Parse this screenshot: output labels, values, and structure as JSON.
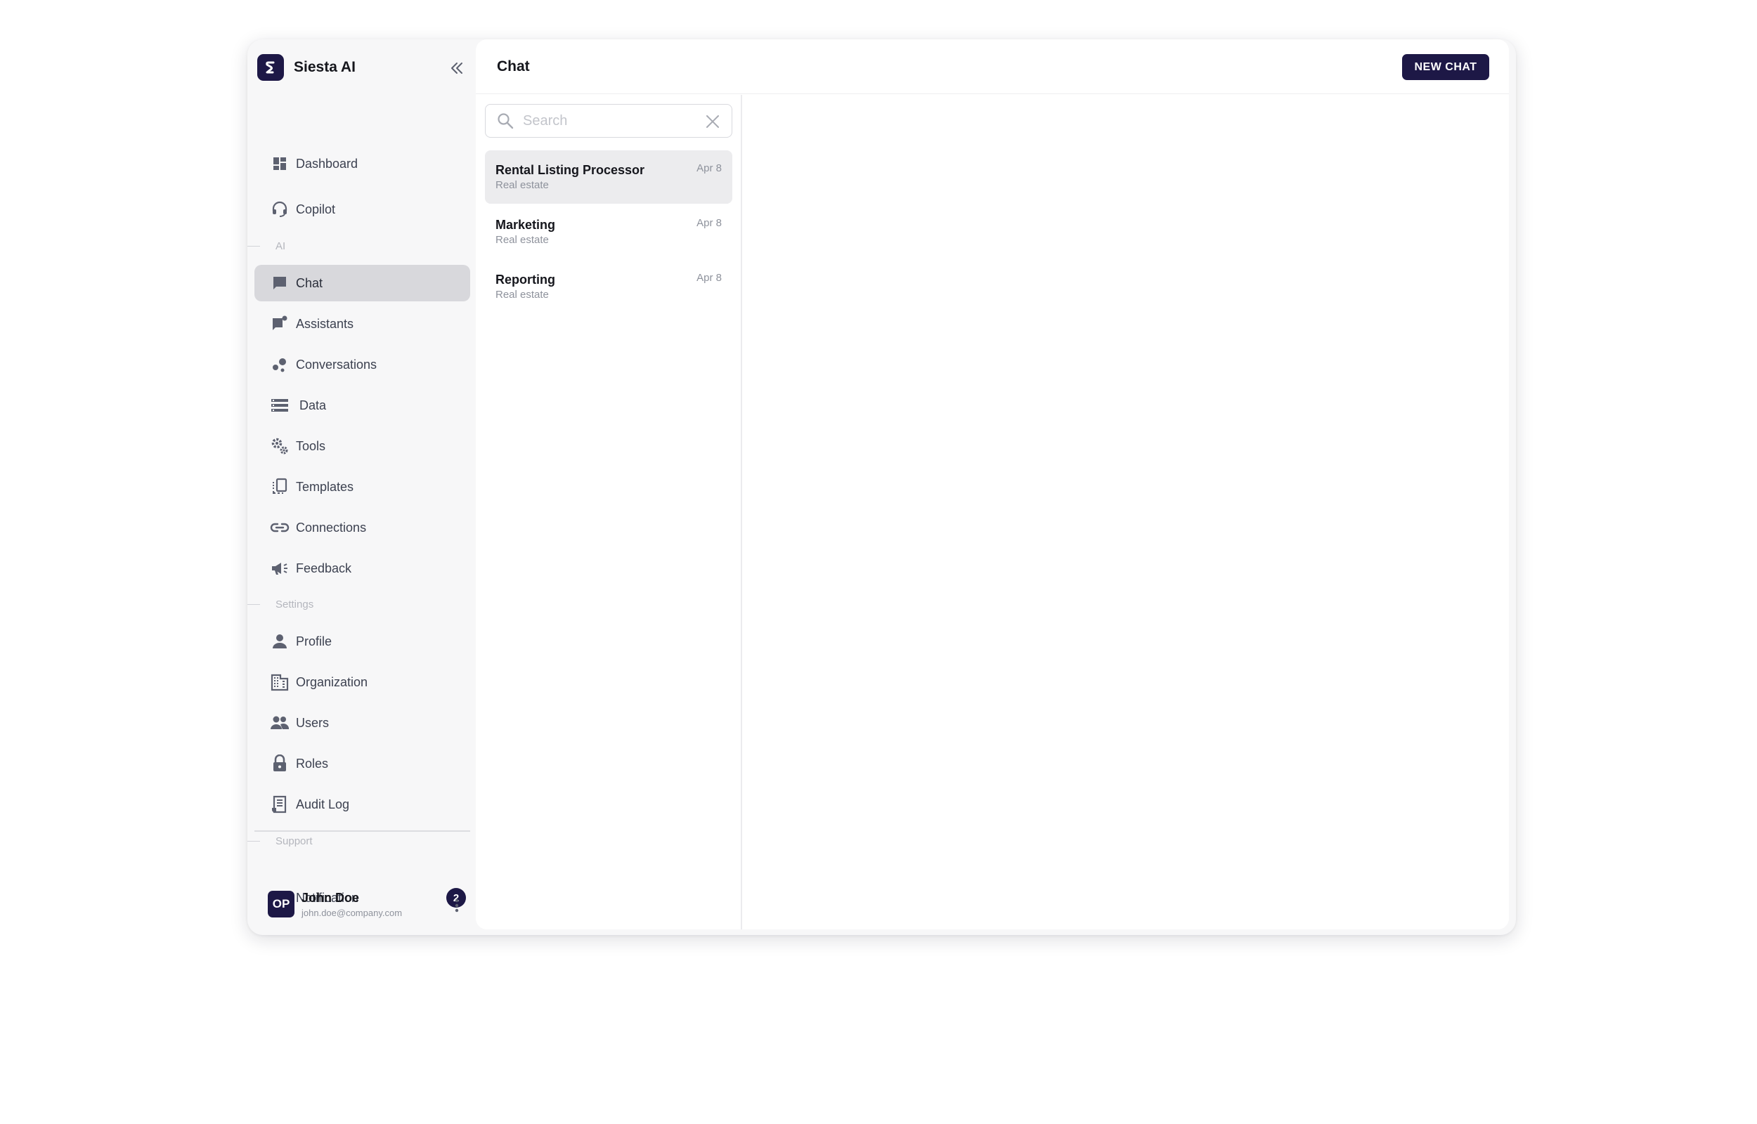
{
  "app": {
    "name": "Siesta AI"
  },
  "colors": {
    "brand": "#1d1846",
    "active_bg": "#d8d8dc",
    "frame_bg": "#f7f7f8"
  },
  "sidebar": {
    "collapse_icon": "double-chevron-left-icon",
    "primary_items": [
      {
        "label": "Dashboard",
        "icon": "dashboard-icon"
      },
      {
        "label": "Copilot",
        "icon": "headset-icon"
      }
    ],
    "sections": {
      "ai": "AI",
      "settings": "Settings",
      "support": "Support"
    },
    "ai_items": [
      {
        "label": "Chat",
        "icon": "chat-bubble-icon",
        "active": true
      },
      {
        "label": "Assistants",
        "icon": "assistant-chat-icon"
      },
      {
        "label": "Conversations",
        "icon": "bubbles-icon"
      },
      {
        "label": "Data",
        "icon": "storage-icon"
      },
      {
        "label": "Tools",
        "icon": "gears-icon"
      },
      {
        "label": "Templates",
        "icon": "templates-icon"
      },
      {
        "label": "Connections",
        "icon": "link-icon"
      },
      {
        "label": "Feedback",
        "icon": "megaphone-icon"
      }
    ],
    "settings_items": [
      {
        "label": "Profile",
        "icon": "person-icon"
      },
      {
        "label": "Organization",
        "icon": "building-icon"
      },
      {
        "label": "Users",
        "icon": "people-icon"
      },
      {
        "label": "Roles",
        "icon": "lock-icon"
      },
      {
        "label": "Audit Log",
        "icon": "receipt-icon"
      }
    ],
    "notification": {
      "label": "Notification",
      "icon": "bell-icon",
      "count": "2"
    },
    "user": {
      "initials": "OP",
      "name": "John Doe",
      "email": "john.doe@company.com",
      "menu_icon": "more-vertical-icon"
    }
  },
  "main": {
    "title": "Chat",
    "new_chat_label": "NEW CHAT",
    "search": {
      "placeholder": "Search",
      "value": ""
    },
    "chats": [
      {
        "title": "Rental Listing Processor",
        "subtitle": "Real estate",
        "date": "Apr 8",
        "selected": true
      },
      {
        "title": "Marketing",
        "subtitle": "Real estate",
        "date": "Apr 8"
      },
      {
        "title": "Reporting",
        "subtitle": "Real estate",
        "date": "Apr 8"
      }
    ]
  }
}
